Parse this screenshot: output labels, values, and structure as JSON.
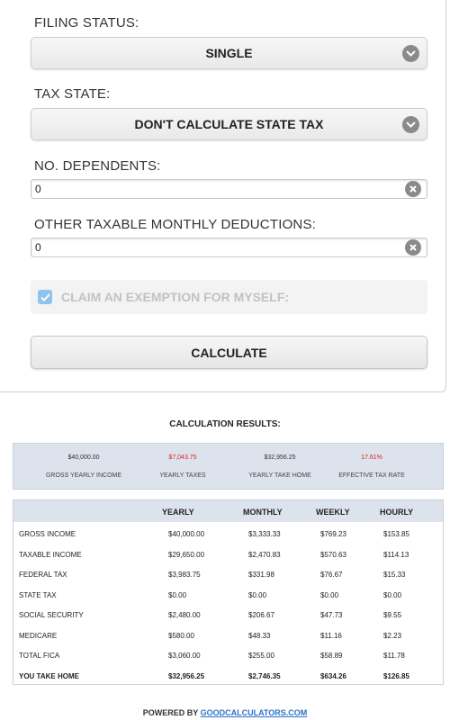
{
  "form": {
    "filing_status": {
      "label": "FILING STATUS:",
      "value": "SINGLE"
    },
    "tax_state": {
      "label": "TAX STATE:",
      "value": "DON'T CALCULATE STATE TAX"
    },
    "dependents": {
      "label": "NO. DEPENDENTS:",
      "value": "0"
    },
    "deductions": {
      "label": "OTHER TAXABLE MONTHLY DEDUCTIONS:",
      "value": "0"
    },
    "exemption": {
      "label": "CLAIM AN EXEMPTION FOR MYSELF:",
      "checked": true
    },
    "calculate_label": "CALCULATE"
  },
  "results": {
    "title": "CALCULATION RESULTS:",
    "summary": [
      {
        "value": "$40,000.00",
        "label": "GROSS YEARLY INCOME",
        "highlight": false
      },
      {
        "value": "$7,043.75",
        "label": "YEARLY TAXES",
        "highlight": true
      },
      {
        "value": "$32,956.25",
        "label": "YEARLY TAKE HOME",
        "highlight": false
      },
      {
        "value": "17.61%",
        "label": "EFFECTIVE TAX RATE",
        "highlight": true
      }
    ],
    "table": {
      "headers": [
        "",
        "YEARLY",
        "MONTHLY",
        "WEEKLY",
        "HOURLY"
      ],
      "rows": [
        [
          "GROSS INCOME",
          "$40,000.00",
          "$3,333.33",
          "$769.23",
          "$153.85"
        ],
        [
          "TAXABLE INCOME",
          "$29,650.00",
          "$2,470.83",
          "$570.63",
          "$114.13"
        ],
        [
          "FEDERAL TAX",
          "$3,983.75",
          "$331.98",
          "$76.67",
          "$15.33"
        ],
        [
          "STATE TAX",
          "$0.00",
          "$0.00",
          "$0.00",
          "$0.00"
        ],
        [
          "SOCIAL SECURITY",
          "$2,480.00",
          "$206.67",
          "$47.73",
          "$9.55"
        ],
        [
          "MEDICARE",
          "$580.00",
          "$48.33",
          "$11.16",
          "$2.23"
        ],
        [
          "TOTAL FICA",
          "$3,060.00",
          "$255.00",
          "$58.89",
          "$11.78"
        ],
        [
          "YOU TAKE HOME",
          "$32,956.25",
          "$2,746.35",
          "$634.26",
          "$126.85"
        ]
      ]
    }
  },
  "footer": {
    "prefix": "POWERED BY ",
    "link_text": "GOODCALCULATORS.COM"
  },
  "colors": {
    "accent_link": "#2a72c8",
    "highlight_red": "#dd2222",
    "panel_blue": "#dde3ec"
  }
}
